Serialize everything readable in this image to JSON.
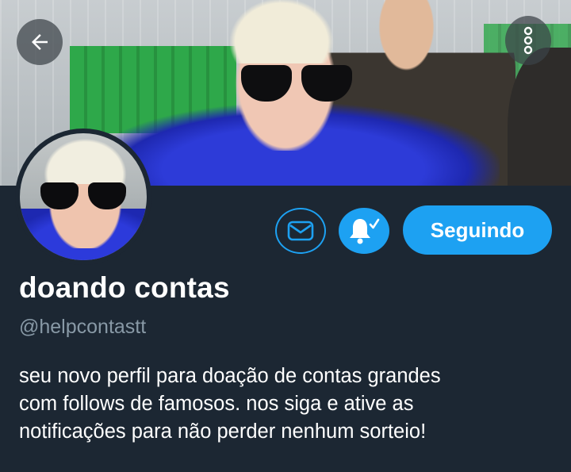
{
  "header": {
    "back_icon": "arrow-left-icon",
    "more_icon": "more-vertical-icon"
  },
  "profile": {
    "display_name": "doando contas",
    "handle": "@helpcontastt",
    "bio_lines": [
      "seu novo perfil para doação de contas grandes",
      "com follows de famosos. nos siga e ative as",
      "notificações para não perder nenhum sorteio!"
    ]
  },
  "actions": {
    "message_icon": "envelope-icon",
    "notifications_icon": "bell-check-icon",
    "follow_label": "Seguindo"
  },
  "colors": {
    "background": "#1c2733",
    "accent": "#1da1f2",
    "secondary_text": "#8899a6"
  }
}
